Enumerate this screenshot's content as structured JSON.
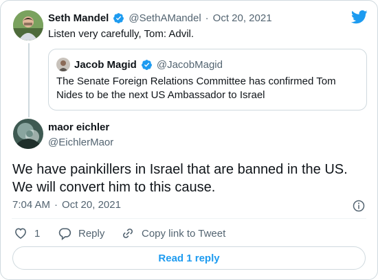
{
  "parent_tweet": {
    "author_name": "Seth Mandel",
    "handle": "@SethAMandel",
    "separator": "·",
    "date": "Oct 20, 2021",
    "text": "Listen very carefully, Tom: Advil."
  },
  "quoted_tweet": {
    "author_name": "Jacob Magid",
    "handle": "@JacobMagid",
    "text_line1": "The Senate Foreign Relations Committee has confirmed Tom",
    "text_line2": "Nides to be the next US Ambassador to Israel"
  },
  "main_tweet": {
    "author_name": "maor eichler",
    "handle": "@EichlerMaor",
    "text_line1": "We have painkillers in Israel that are banned in the US.",
    "text_line2": "We will convert him to this cause.",
    "time": "7:04 AM",
    "separator": "·",
    "date": "Oct 20, 2021"
  },
  "actions": {
    "like_count": "1",
    "reply_label": "Reply",
    "copy_link_label": "Copy link to Tweet"
  },
  "read_replies_label": "Read 1 reply",
  "colors": {
    "brand": "#1d9bf0",
    "muted": "#536471",
    "border": "#cfd9de"
  },
  "icons": [
    "twitter-bird-icon",
    "verified-badge-icon",
    "info-icon",
    "heart-icon",
    "reply-icon",
    "link-icon"
  ]
}
